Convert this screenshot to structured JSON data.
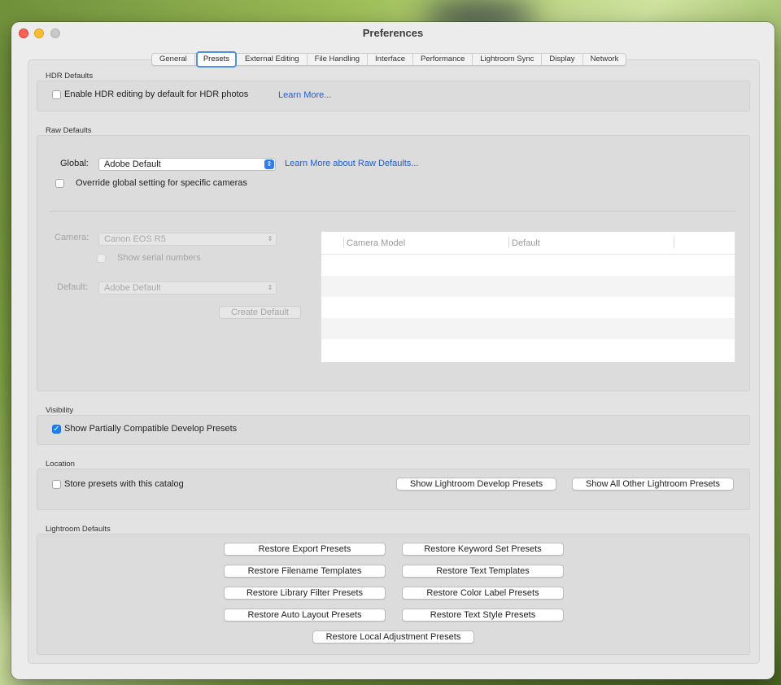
{
  "window": {
    "title": "Preferences"
  },
  "tabs": [
    {
      "label": "General",
      "active": false
    },
    {
      "label": "Presets",
      "active": true
    },
    {
      "label": "External Editing",
      "active": false
    },
    {
      "label": "File Handling",
      "active": false
    },
    {
      "label": "Interface",
      "active": false
    },
    {
      "label": "Performance",
      "active": false
    },
    {
      "label": "Lightroom Sync",
      "active": false
    },
    {
      "label": "Display",
      "active": false
    },
    {
      "label": "Network",
      "active": false
    }
  ],
  "hdr": {
    "section_label": "HDR Defaults",
    "checkbox_label": "Enable HDR editing by default for HDR photos",
    "checked": false,
    "learn_more": "Learn More..."
  },
  "raw": {
    "section_label": "Raw Defaults",
    "global_label": "Global:",
    "global_value": "Adobe Default",
    "learn_more": "Learn More about Raw Defaults...",
    "override_label": "Override global setting for specific cameras",
    "override_checked": false,
    "camera_label": "Camera:",
    "camera_value": "Canon EOS R5",
    "serial_label": "Show serial numbers",
    "default_label": "Default:",
    "default_value": "Adobe Default",
    "create_default": "Create Default",
    "table_headers": [
      "Camera Model",
      "Default"
    ]
  },
  "visibility": {
    "section_label": "Visibility",
    "checkbox_label": "Show Partially Compatible Develop Presets",
    "checked": true
  },
  "location": {
    "section_label": "Location",
    "checkbox_label": "Store presets with this catalog",
    "checked": false,
    "show_develop": "Show Lightroom Develop Presets",
    "show_other": "Show All Other Lightroom Presets"
  },
  "defaults": {
    "section_label": "Lightroom Defaults",
    "buttons": [
      "Restore Export Presets",
      "Restore Keyword Set Presets",
      "Restore Filename Templates",
      "Restore Text Templates",
      "Restore Library Filter Presets",
      "Restore Color Label Presets",
      "Restore Auto Layout Presets",
      "Restore Text Style Presets",
      "Restore Local Adjustment Presets"
    ]
  },
  "colors": {
    "accent": "#1a7ef5",
    "link": "#1b5fd9",
    "close": "#ff5f57",
    "minimize": "#febc2e"
  }
}
